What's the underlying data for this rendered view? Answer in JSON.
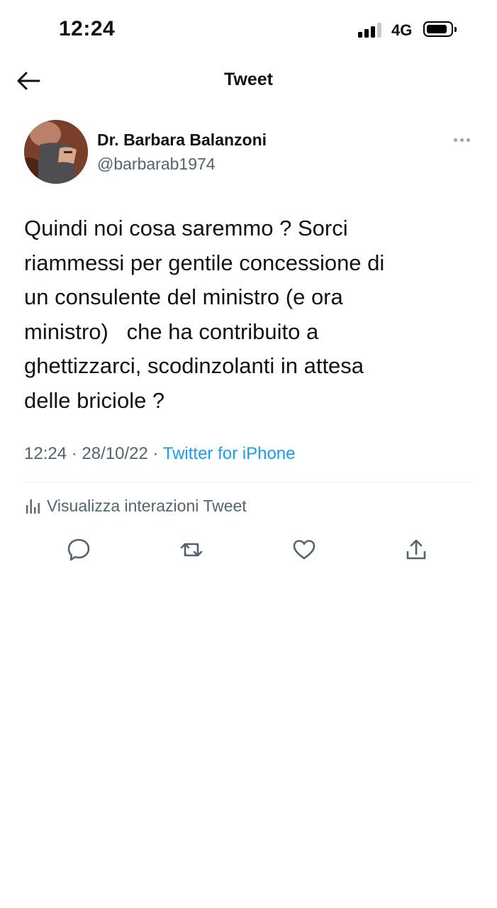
{
  "status_bar": {
    "time": "12:24",
    "network": "4G"
  },
  "nav": {
    "title": "Tweet",
    "back_icon": "arrow-left-icon"
  },
  "tweet": {
    "author_name": "Dr. Barbara Balanzoni",
    "author_handle": "@barbarab1974",
    "text_lines": [
      "Quindi noi cosa saremmo ? Sorci",
      "riammessi per gentile concessione di",
      "un consulente del ministro (e ora",
      "ministro)   che ha contribuito a",
      "ghettizzarci, scodinzolanti in attesa",
      "delle briciole ?"
    ],
    "time": "12:24",
    "date": "28/10/22",
    "separator": "·",
    "source": "Twitter for iPhone"
  },
  "analytics": {
    "label": "Visualizza interazioni Tweet",
    "icon": "bar-chart-icon"
  },
  "actions": {
    "icons": [
      "reply-icon",
      "retweet-icon",
      "like-icon",
      "share-icon"
    ]
  },
  "colors": {
    "text_primary": "#0f1419",
    "text_secondary": "#536471",
    "accent": "#1d9bf0",
    "divider": "#eff3f4"
  }
}
